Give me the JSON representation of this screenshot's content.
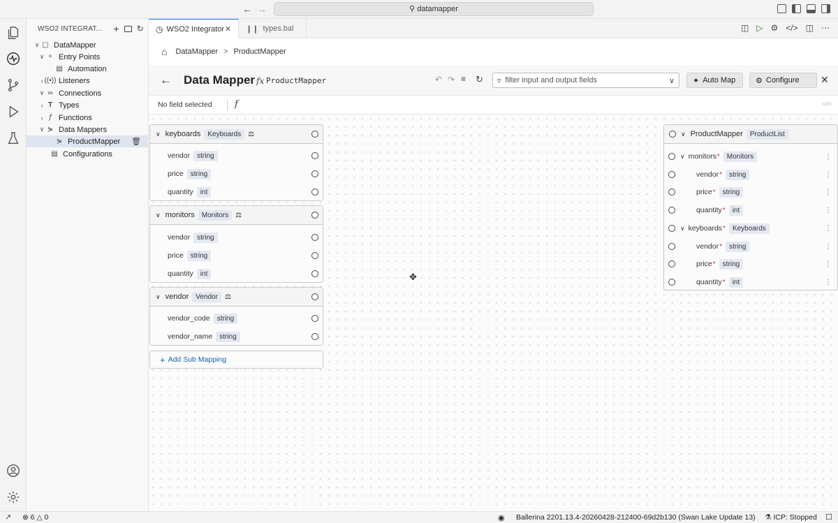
{
  "titlebar": {
    "search_text": "datamapper"
  },
  "sidebar": {
    "header": "WSO2 INTEGRAT...",
    "items": [
      {
        "label": "DataMapper"
      },
      {
        "label": "Entry Points"
      },
      {
        "label": "Automation"
      },
      {
        "label": "Listeners"
      },
      {
        "label": "Connections"
      },
      {
        "label": "Types"
      },
      {
        "label": "Functions"
      },
      {
        "label": "Data Mappers"
      },
      {
        "label": "ProductMapper"
      },
      {
        "label": "Configurations"
      }
    ]
  },
  "tabs": [
    {
      "label": "WSO2 Integrator"
    },
    {
      "label": "types.bal"
    }
  ],
  "breadcrumb": {
    "first": "DataMapper",
    "separator": ">",
    "second": "ProductMapper"
  },
  "mapper": {
    "title": "Data Mapper",
    "fx_symbol": "fx",
    "function_name": "ProductMapper",
    "filter_placeholder": "filter input and output fields",
    "auto_map_label": "Auto Map",
    "configure_label": "Configure",
    "field_status": "No field selected",
    "fn_symbol": "f",
    "code_symbol": "</>"
  },
  "inputs": [
    {
      "name": "keyboards",
      "type": "Keyboards",
      "fields": [
        {
          "name": "vendor",
          "type": "string"
        },
        {
          "name": "price",
          "type": "string"
        },
        {
          "name": "quantity",
          "type": "int"
        }
      ]
    },
    {
      "name": "monitors",
      "type": "Monitors",
      "fields": [
        {
          "name": "vendor",
          "type": "string"
        },
        {
          "name": "price",
          "type": "string"
        },
        {
          "name": "quantity",
          "type": "int"
        }
      ]
    },
    {
      "name": "vendor",
      "type": "Vendor",
      "fields": [
        {
          "name": "vendor_code",
          "type": "string"
        },
        {
          "name": "vendor_name",
          "type": "string"
        }
      ]
    }
  ],
  "add_sub_mapping_label": "Add Sub Mapping",
  "output": {
    "name": "ProductMapper",
    "type": "ProductList",
    "groups": [
      {
        "name": "monitors",
        "type": "Monitors",
        "fields": [
          {
            "name": "vendor",
            "type": "string"
          },
          {
            "name": "price",
            "type": "string"
          },
          {
            "name": "quantity",
            "type": "int"
          }
        ]
      },
      {
        "name": "keyboards",
        "type": "Keyboards",
        "fields": [
          {
            "name": "vendor",
            "type": "string"
          },
          {
            "name": "price",
            "type": "string"
          },
          {
            "name": "quantity",
            "type": "int"
          }
        ]
      }
    ]
  },
  "statusbar": {
    "errors": "6",
    "warnings": "0",
    "ballerina": "Ballerina 2201.13.4-20260428-212400-69d2b130 (Swan Lake Update 13)",
    "icp": "ICP: Stopped"
  },
  "colors": {
    "accent": "#1a73e8",
    "badge_bg": "#e3e8f3",
    "required": "#d32f2f"
  }
}
